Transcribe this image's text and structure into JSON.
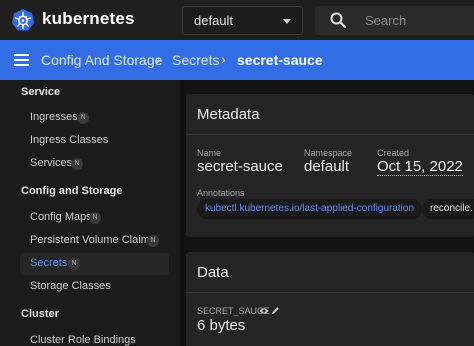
{
  "header": {
    "brand": "kubernetes",
    "namespace": {
      "selected": "default"
    },
    "search": {
      "placeholder": "Search"
    }
  },
  "breadcrumb": {
    "items": [
      "Config And Storage",
      "Secrets",
      "secret-sauce"
    ]
  },
  "sidebar": {
    "sections": [
      {
        "title": "Service"
      },
      {
        "title": "Config and Storage"
      },
      {
        "title": "Cluster"
      }
    ],
    "items": [
      {
        "label": "Ingresses",
        "badge": "N"
      },
      {
        "label": "Ingress Classes"
      },
      {
        "label": "Services",
        "badge": "N"
      },
      {
        "label": "Config Maps",
        "badge": "N"
      },
      {
        "label": "Persistent Volume Claims",
        "badge": "N"
      },
      {
        "label": "Secrets",
        "badge": "N",
        "active": true
      },
      {
        "label": "Storage Classes"
      },
      {
        "label": "Cluster Role Bindings"
      }
    ]
  },
  "metadata": {
    "title": "Metadata",
    "name_label": "Name",
    "name": "secret-sauce",
    "namespace_label": "Namespace",
    "namespace": "default",
    "created_label": "Created",
    "created": "Oct 15, 2022",
    "annotations_label": "Annotations",
    "annotations": [
      "kubectl.kubernetes.io/last-applied-configuration",
      "reconcile."
    ]
  },
  "data_card": {
    "title": "Data",
    "key": "SECRET_SAUCE",
    "value": "6 bytes"
  },
  "colors": {
    "accent": "#326de6",
    "link": "#5b8ff2",
    "background": "#121212",
    "card": "#242424"
  }
}
